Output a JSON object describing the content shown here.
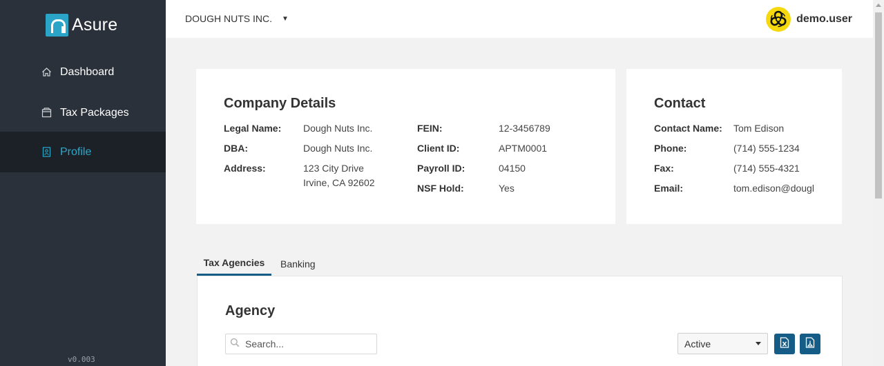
{
  "app": {
    "logo_text": "Asure",
    "version": "v0.003"
  },
  "sidebar": {
    "items": [
      {
        "label": "Dashboard",
        "icon": "home-icon"
      },
      {
        "label": "Tax Packages",
        "icon": "package-icon"
      },
      {
        "label": "Profile",
        "icon": "profile-icon",
        "active": true
      }
    ]
  },
  "header": {
    "company": "DOUGH NUTS INC.",
    "username": "demo.user",
    "avatar_icon": "biohazard-icon"
  },
  "company_details": {
    "title": "Company Details",
    "legal_name_label": "Legal Name:",
    "legal_name": "Dough Nuts Inc.",
    "dba_label": "DBA:",
    "dba": "Dough Nuts Inc.",
    "address_label": "Address:",
    "address_line1": "123 City Drive",
    "address_line2": "Irvine, CA 92602",
    "fein_label": "FEIN:",
    "fein": "12-3456789",
    "client_id_label": "Client ID:",
    "client_id": "APTM0001",
    "payroll_id_label": "Payroll ID:",
    "payroll_id": "04150",
    "nsf_hold_label": "NSF Hold:",
    "nsf_hold": "Yes"
  },
  "contact": {
    "title": "Contact",
    "name_label": "Contact Name:",
    "name": "Tom Edison",
    "phone_label": "Phone:",
    "phone": "(714) 555-1234",
    "fax_label": "Fax:",
    "fax": "(714) 555-4321",
    "email_label": "Email:",
    "email": "tom.edison@dougl"
  },
  "tabs": [
    {
      "label": "Tax Agencies",
      "active": true
    },
    {
      "label": "Banking"
    }
  ],
  "agency": {
    "title": "Agency",
    "search_placeholder": "Search...",
    "status_value": "Active",
    "export_excel_icon": "excel-export-icon",
    "export_pdf_icon": "pdf-export-icon"
  },
  "colors": {
    "sidebar_bg": "#2b313a",
    "active_accent": "#2aa9cc",
    "primary_button": "#155d86"
  }
}
